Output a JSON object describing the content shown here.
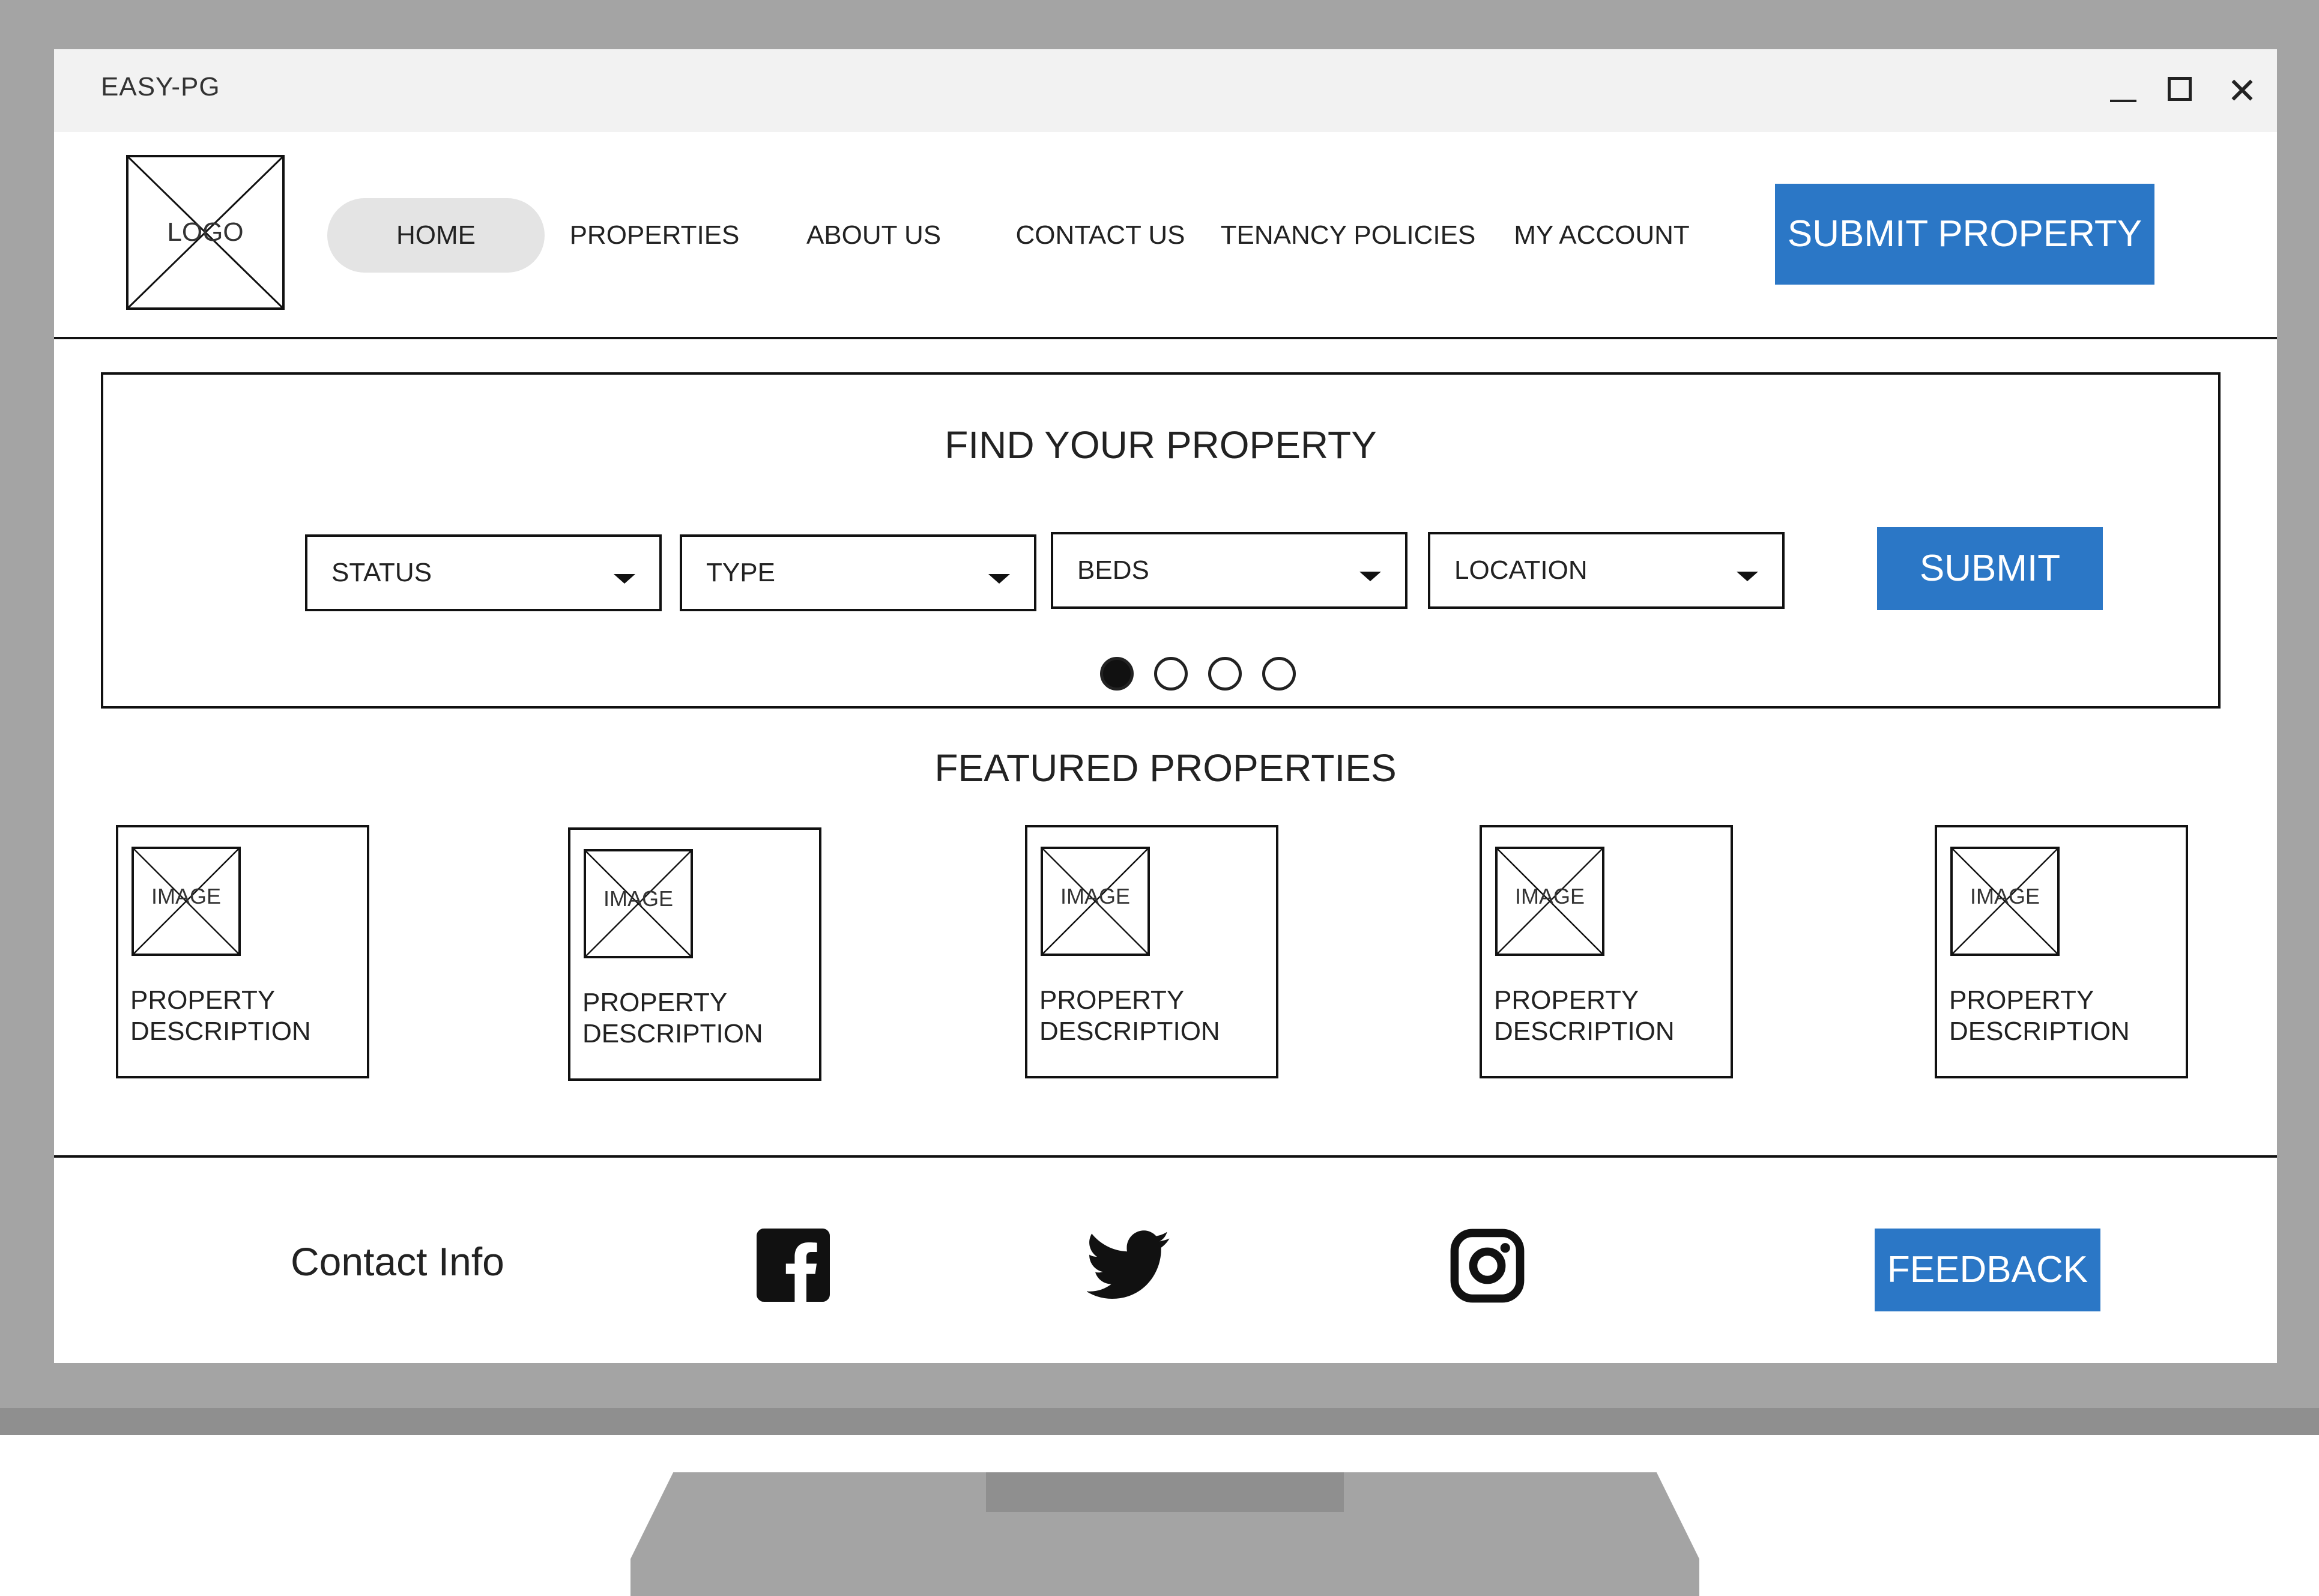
{
  "window": {
    "title": "EASY-PG"
  },
  "header": {
    "logo_label": "LOGO",
    "nav": [
      {
        "label": "HOME",
        "active": true
      },
      {
        "label": "PROPERTIES"
      },
      {
        "label": "ABOUT US"
      },
      {
        "label": "CONTACT US"
      },
      {
        "label": "TENANCY POLICIES"
      },
      {
        "label": "MY ACCOUNT"
      }
    ],
    "submit_property_label": "SUBMIT PROPERTY"
  },
  "search": {
    "title": "FIND YOUR PROPERTY",
    "filters": [
      {
        "label": "STATUS"
      },
      {
        "label": "TYPE"
      },
      {
        "label": "BEDS"
      },
      {
        "label": "LOCATION"
      }
    ],
    "submit_label": "SUBMIT",
    "carousel": {
      "count": 4,
      "active_index": 0
    }
  },
  "featured": {
    "title": "FEATURED PROPERTIES",
    "cards": [
      {
        "image_label": "IMAGE",
        "desc_line1": "PROPERTY",
        "desc_line2": "DESCRIPTION"
      },
      {
        "image_label": "IMAGE",
        "desc_line1": "PROPERTY",
        "desc_line2": "DESCRIPTION"
      },
      {
        "image_label": "IMAGE",
        "desc_line1": "PROPERTY",
        "desc_line2": "DESCRIPTION"
      },
      {
        "image_label": "IMAGE",
        "desc_line1": "PROPERTY",
        "desc_line2": "DESCRIPTION"
      },
      {
        "image_label": "IMAGE",
        "desc_line1": "PROPERTY",
        "desc_line2": "DESCRIPTION"
      }
    ]
  },
  "footer": {
    "contact_label": "Contact Info",
    "social_icons": [
      "facebook-icon",
      "twitter-icon",
      "instagram-icon"
    ],
    "feedback_label": "FEEDBACK"
  },
  "colors": {
    "accent": "#2b77c6",
    "bezel": "#a4a4a4",
    "titlebar": "#f2f2f2",
    "active_nav": "#e4e4e4"
  }
}
